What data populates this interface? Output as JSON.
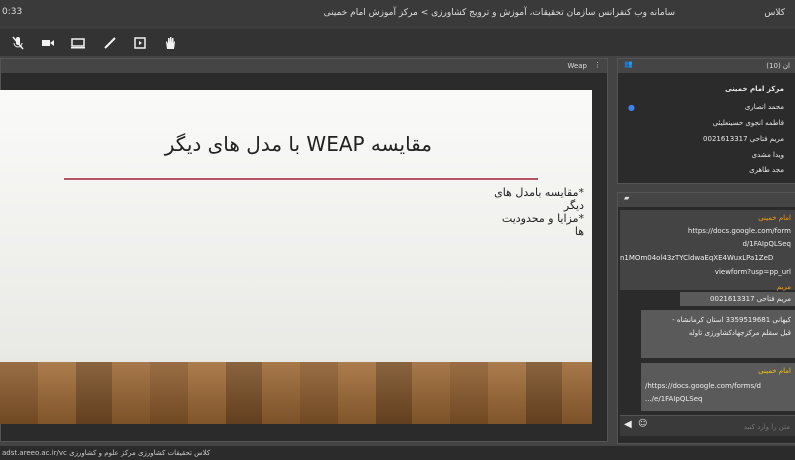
{
  "titlebar": {
    "time": "0:33",
    "title": "سامانه وب کنفرانس سازمان تحقیقات، آموزش و ترویج کشاورزی > مرکز آموزش امام خمینی",
    "title_suffix": "کلاس"
  },
  "toolbar": {
    "icons": [
      "mic-off-icon",
      "camera-icon",
      "screen-share-icon",
      "draw-icon",
      "video-pod-icon",
      "raise-hand-icon"
    ]
  },
  "share_pod": {
    "title": "Weap",
    "slide": {
      "title": "مقایسه WEAP با مدل های دیگر",
      "bullets": [
        "*مقایسه بامدل های دیگر",
        "*مزایا و محدودیت ها"
      ]
    }
  },
  "attendees": {
    "header": "ان (10)",
    "host": "مرکز امام خمینی",
    "names": [
      "محمد انصاری",
      "فاطمه انجوی حسینعلیئی",
      "مریم فتاحی 0021613317",
      "ویدا مشدی",
      "مجد طاهری"
    ]
  },
  "chat": {
    "sender1": "امام خمینی",
    "link1_lines": [
      "https://docs.google.com/form",
      "d/1FAIpQLSeq",
      "n1MOm04ol43zTYCldwaEqXE4WuxLPa1ZeD",
      "viewform?usp=pp_url"
    ],
    "sender2": "مریم",
    "msg2": "مریم فتاحی 0021613317",
    "msg3_line1": "کیهانی 3359519681 استان کرمانشاه -",
    "msg3_line2": "قبل سقلم مرکزجهادکشاورزی تاوله",
    "sender4": "امام خمینی",
    "link4_lines": [
      "https://docs.google.com/forms/d/",
      "e/1FAIpQLSeq/..."
    ],
    "input_placeholder": "متن را وارد کنید",
    "status": "adst.areeo.ac.ir/vc کلاس تحقیقات کشاورزی مرکز علوم و کشاورزی"
  }
}
